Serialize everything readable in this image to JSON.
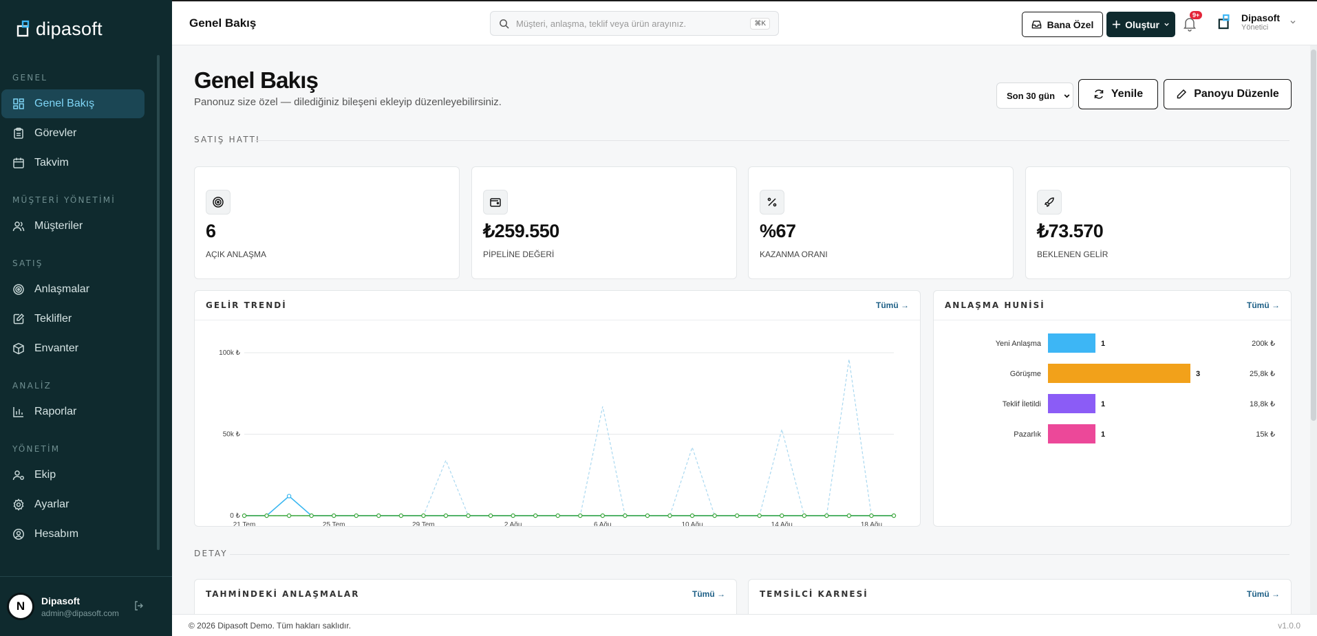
{
  "brand": {
    "name": "dipasoft"
  },
  "sidebar": {
    "sections": [
      {
        "title": "GENEL",
        "items": [
          {
            "label": "Genel Bakış",
            "icon": "dashboard-icon",
            "active": true
          },
          {
            "label": "Görevler",
            "icon": "clipboard-icon"
          },
          {
            "label": "Takvim",
            "icon": "calendar-icon"
          }
        ]
      },
      {
        "title": "MÜŞTERİ YÖNETİMİ",
        "items": [
          {
            "label": "Müşteriler",
            "icon": "users-icon"
          }
        ]
      },
      {
        "title": "SATIŞ",
        "items": [
          {
            "label": "Anlaşmalar",
            "icon": "target-icon"
          },
          {
            "label": "Teklifler",
            "icon": "edit-icon"
          },
          {
            "label": "Envanter",
            "icon": "box-icon"
          }
        ]
      },
      {
        "title": "ANALİZ",
        "items": [
          {
            "label": "Raporlar",
            "icon": "bar-chart-icon"
          }
        ]
      },
      {
        "title": "YÖNETİM",
        "items": [
          {
            "label": "Ekip",
            "icon": "team-icon"
          },
          {
            "label": "Ayarlar",
            "icon": "gear-icon"
          },
          {
            "label": "Hesabım",
            "icon": "user-circle-icon"
          }
        ]
      }
    ],
    "user": {
      "initial": "N",
      "name": "Dipasoft",
      "email": "admin@dipasoft.com"
    }
  },
  "topbar": {
    "title": "Genel Bakış",
    "search_placeholder": "Müşteri, anlaşma, teklif veya ürün arayınız.",
    "shortcut": "⌘K",
    "btn_personal": "Bana Özel",
    "btn_create": "Oluştur",
    "notif_badge": "9+",
    "profile_name": "Dipasoft",
    "profile_role": "Yönetici"
  },
  "page": {
    "title": "Genel Bakış",
    "subtitle": "Panonuz size özel — dilediğiniz bileşeni ekleyip düzenleyebilirsiniz.",
    "range": "Son 30 gün",
    "btn_refresh": "Yenile",
    "btn_edit": "Panoyu Düzenle",
    "section_sales": "SATIŞ HATTI",
    "section_detail": "DETAY"
  },
  "kpis": [
    {
      "value": "6",
      "label": "AÇIK ANLAŞMA",
      "icon": "target-icon"
    },
    {
      "value": "₺259.550",
      "label": "PİPELİNE DEĞERİ",
      "icon": "wallet-icon"
    },
    {
      "value": "%67",
      "label": "KAZANMA ORANI",
      "icon": "percent-icon"
    },
    {
      "value": "₺73.570",
      "label": "BEKLENEN GELİR",
      "icon": "rocket-icon"
    }
  ],
  "cards": {
    "revenue_trend": {
      "title": "GELİR TRENDİ",
      "link": "Tümü"
    },
    "funnel": {
      "title": "ANLAŞMA HUNİSİ",
      "link": "Tümü"
    },
    "forecast": {
      "title": "TAHMİNDEKİ ANLAŞMALAR",
      "link": "Tümü"
    },
    "rep_card": {
      "title": "TEMSİLCİ KARNESİ",
      "link": "Tümü"
    }
  },
  "chart_data": [
    {
      "type": "line",
      "x_ticks": [
        "21 Tem",
        "25 Tem",
        "29 Tem",
        "2 Ağu",
        "6 Ağu",
        "10 Ağu",
        "14 Ağu",
        "18 Ağu"
      ],
      "y_ticks": [
        "0 ₺",
        "50k ₺",
        "100k ₺"
      ],
      "ylim": [
        0,
        100000
      ],
      "grid": true,
      "series": [
        {
          "color": "#38b6f0",
          "style": "solid",
          "values": [
            0,
            0,
            12000,
            0,
            0,
            0,
            0,
            0,
            0,
            0,
            0,
            0,
            0,
            0,
            0,
            0,
            0,
            0,
            0,
            0,
            0,
            0,
            0,
            0,
            0,
            0,
            0,
            0,
            0,
            0
          ]
        },
        {
          "color": "#a9d8f0",
          "style": "dashed",
          "values": [
            0,
            0,
            0,
            0,
            0,
            0,
            0,
            0,
            0,
            34000,
            0,
            0,
            0,
            0,
            0,
            0,
            67000,
            0,
            0,
            0,
            42000,
            0,
            0,
            0,
            53000,
            0,
            0,
            96000,
            0,
            0
          ]
        },
        {
          "color": "#3aa63a",
          "style": "solid",
          "values": [
            0,
            0,
            0,
            0,
            0,
            0,
            0,
            0,
            0,
            0,
            0,
            0,
            0,
            0,
            0,
            0,
            0,
            0,
            0,
            0,
            0,
            0,
            0,
            0,
            0,
            0,
            0,
            0,
            0,
            0
          ]
        }
      ]
    },
    {
      "type": "bar",
      "orientation": "horizontal",
      "categories": [
        "Yeni Anlaşma",
        "Görüşme",
        "Teklif İletildi",
        "Pazarlık"
      ],
      "values": [
        1,
        3,
        1,
        1
      ],
      "amounts": [
        "200k ₺",
        "25,8k ₺",
        "18,8k ₺",
        "15k ₺"
      ],
      "colors": [
        "#3db6f5",
        "#f2a11a",
        "#8b5cf6",
        "#ec4899"
      ]
    }
  ],
  "footer": {
    "copyright": "© 2026 Dipasoft Demo. Tüm hakları saklıdır.",
    "version": "v1.0.0"
  }
}
